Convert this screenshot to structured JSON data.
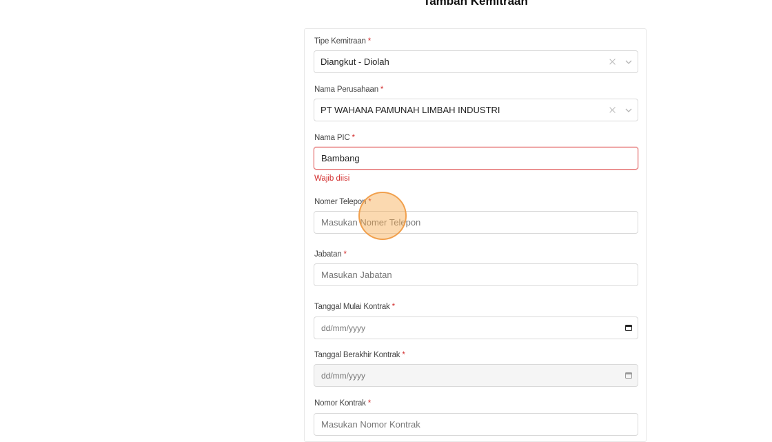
{
  "page": {
    "title": "Tambah Kemitraan"
  },
  "form": {
    "tipe_kemitraan": {
      "label": "Tipe Kemitraan",
      "required": "*",
      "value": "Diangkut - Diolah"
    },
    "nama_perusahaan": {
      "label": "Nama Perusahaan",
      "required": "*",
      "value": "PT WAHANA PAMUNAH LIMBAH INDUSTRI"
    },
    "nama_pic": {
      "label": "Nama PIC",
      "required": "*",
      "value": "Bambang",
      "error": "Wajib diisi"
    },
    "nomer_telepon": {
      "label": "Nomer Telepon",
      "required": "*",
      "placeholder": "Masukan Nomer Telepon"
    },
    "jabatan": {
      "label": "Jabatan",
      "required": "*",
      "placeholder": "Masukan Jabatan"
    },
    "tanggal_mulai": {
      "label": "Tanggal Mulai Kontrak",
      "required": "*",
      "placeholder": "dd/mm/yyyy"
    },
    "tanggal_berakhir": {
      "label": "Tanggal Berakhir Kontrak",
      "required": "*",
      "placeholder": "dd/mm/yyyy"
    },
    "nomor_kontrak": {
      "label": "Nomor Kontrak",
      "required": "*",
      "placeholder": "Masukan Nomor Kontrak"
    }
  },
  "colors": {
    "error": "#d32f2f",
    "cursor_highlight": "#f7aa50"
  }
}
